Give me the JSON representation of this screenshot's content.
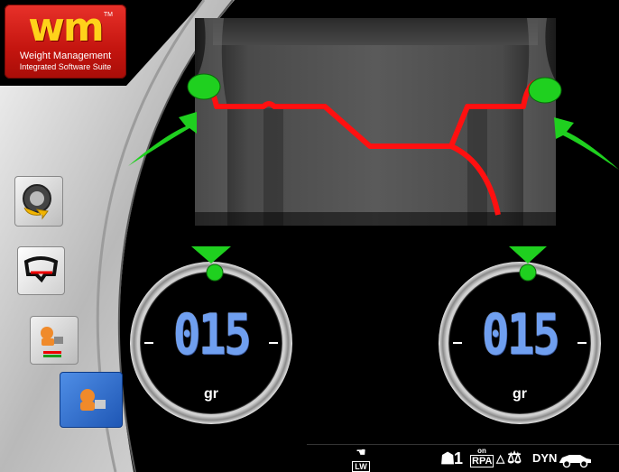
{
  "logo": {
    "mark": "wm",
    "tm": "TM",
    "line1": "Weight Management",
    "line2": "Integrated Software Suite"
  },
  "sidebar": {
    "items": [
      {
        "icon": "wheel-spin-icon"
      },
      {
        "icon": "tire-profile-icon"
      },
      {
        "icon": "operator-weight-icon"
      },
      {
        "icon": "operator-weight-active-icon",
        "active": true
      }
    ]
  },
  "dials": [
    {
      "value": "015",
      "unit": "gr"
    },
    {
      "value": "015",
      "unit": "gr"
    }
  ],
  "statusbar": {
    "lw_label": "LW",
    "man_icon": "operator-icon",
    "one": "1",
    "rpa_on": "on",
    "rpa": "RPA",
    "tri": "△",
    "dyn": "DYN"
  },
  "colors": {
    "accent_red": "#e8312a",
    "logo_yellow": "#ffd21a",
    "indicator_green": "#1fd01f",
    "rim_red": "#ff0000",
    "digits_blue": "#6f9ff0",
    "active_blue": "#2a64c8"
  }
}
